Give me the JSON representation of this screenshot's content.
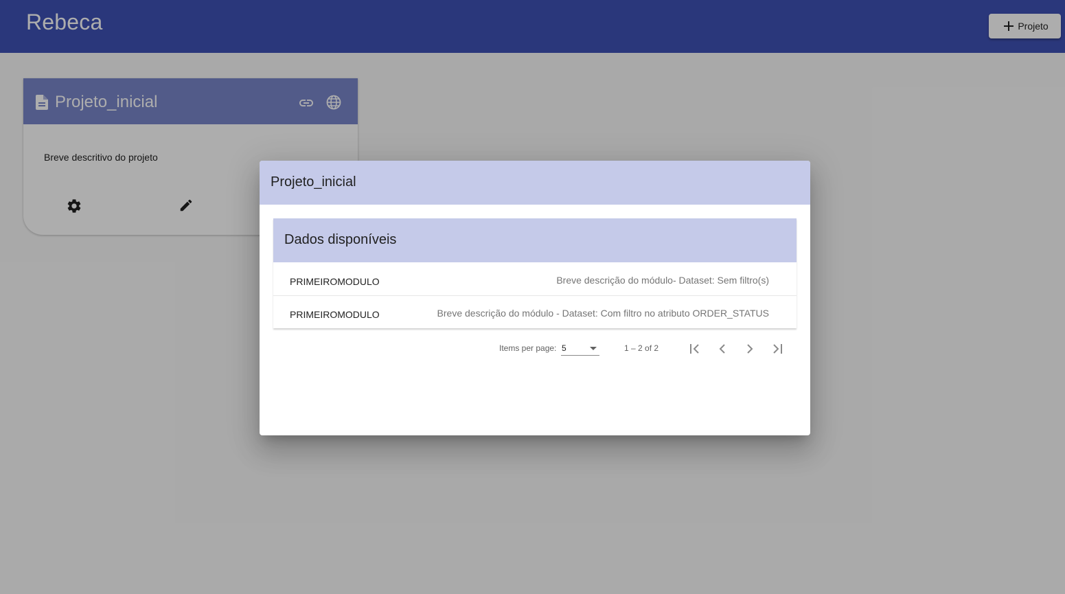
{
  "app": {
    "title": "Rebeca",
    "new_project_label": "Projeto"
  },
  "card": {
    "title": "Projeto_inicial",
    "description": "Breve descritivo do projeto"
  },
  "dialog": {
    "title": "Projeto_inicial",
    "panel_title": "Dados disponíveis",
    "rows": [
      {
        "name": "PRIMEIROMODULO",
        "description": "Breve descrição do módulo- Dataset: Sem filtro(s)"
      },
      {
        "name": "PRIMEIROMODULO",
        "description": "Breve descrição do módulo - Dataset: Com filtro no atributo ORDER_STATUS"
      }
    ],
    "paginator": {
      "items_per_page_label": "Items per page:",
      "page_size": "5",
      "range_label": "1 – 2 of 2"
    }
  },
  "colors": {
    "app_bar": "#3f51b5",
    "card_header": "#7986cb",
    "dialog_header": "#c5cae9"
  }
}
